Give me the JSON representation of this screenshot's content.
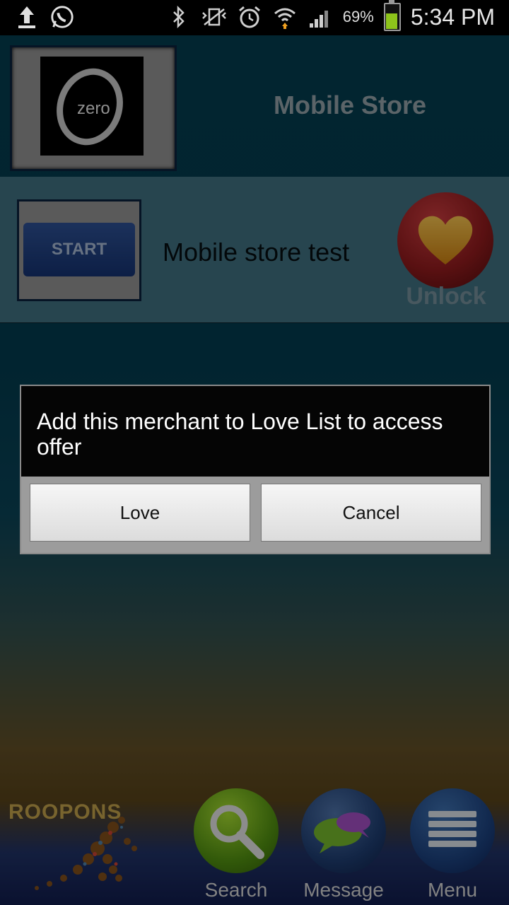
{
  "status_bar": {
    "battery_percent": "69%",
    "battery_level": 0.69,
    "time": "5:34 PM",
    "icons": [
      "upload-icon",
      "whatsapp-icon",
      "bluetooth-icon",
      "vibrate-icon",
      "alarm-icon",
      "wifi-icon",
      "signal-icon",
      "battery-icon"
    ]
  },
  "header": {
    "logo_text": "zero",
    "title": "Mobile Store"
  },
  "offer": {
    "start_label": "START",
    "text": "Mobile store test",
    "unlock_label": "Unlock"
  },
  "dialog": {
    "message": "Add this merchant to Love List to access offer",
    "love_label": "Love",
    "cancel_label": "Cancel"
  },
  "bottom_nav": {
    "brand": "ROOPONS",
    "items": [
      {
        "label": "Search",
        "icon": "magnifier-icon"
      },
      {
        "label": "Message",
        "icon": "speech-bubbles-icon"
      },
      {
        "label": "Menu",
        "icon": "menu-lines-icon"
      }
    ]
  },
  "colors": {
    "background_top": "#04394a",
    "accent_green": "#8ec41b",
    "unlock_red": "#8a1a1c"
  }
}
